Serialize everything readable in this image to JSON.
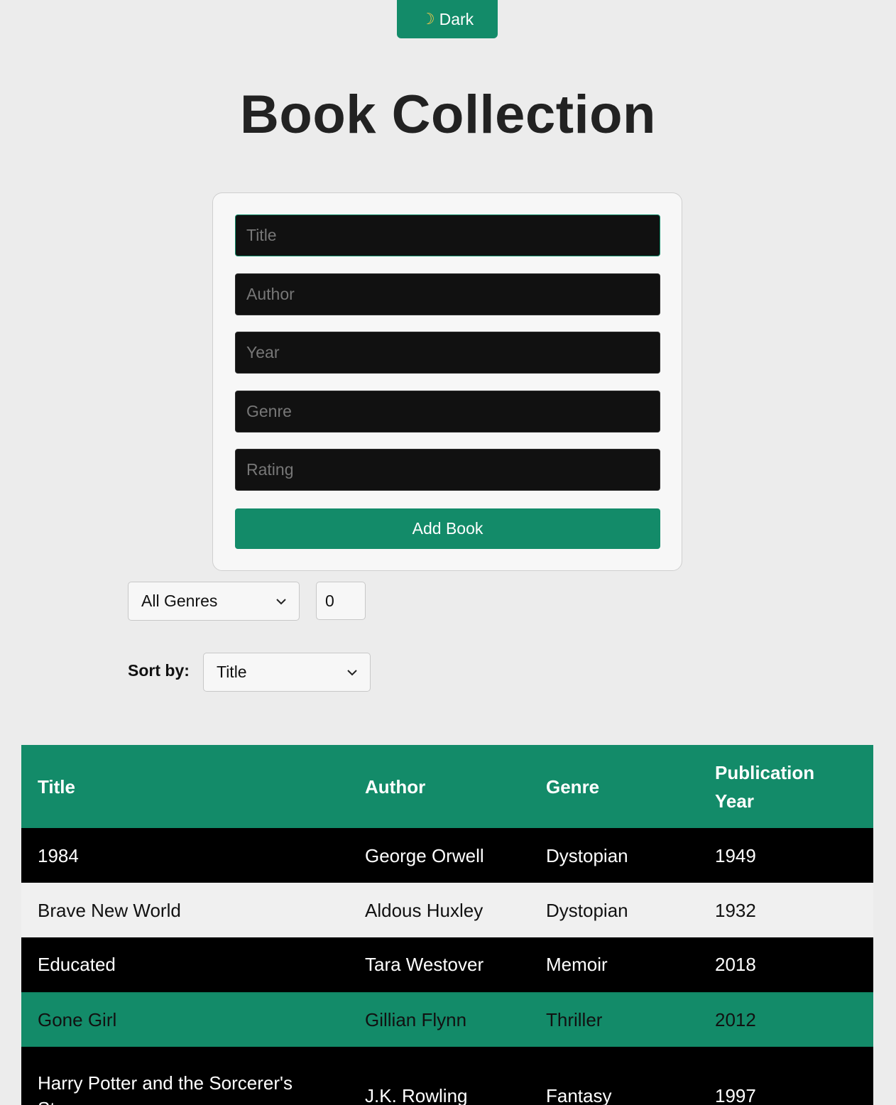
{
  "theme_toggle": {
    "icon": "moon-icon",
    "label": "Dark"
  },
  "page": {
    "title": "Book Collection"
  },
  "form": {
    "title_placeholder": "Title",
    "author_placeholder": "Author",
    "year_placeholder": "Year",
    "genre_placeholder": "Genre",
    "rating_placeholder": "Rating",
    "submit_label": "Add Book"
  },
  "filters": {
    "genre_selected": "All Genres",
    "min_rating_value": "0",
    "sort_label": "Sort by:",
    "sort_selected": "Title"
  },
  "table": {
    "headers": [
      "Title",
      "Author",
      "Genre",
      "Publication Year"
    ],
    "rows": [
      [
        "1984",
        "George Orwell",
        "Dystopian",
        "1949"
      ],
      [
        "Brave New World",
        "Aldous Huxley",
        "Dystopian",
        "1932"
      ],
      [
        "Educated",
        "Tara Westover",
        "Memoir",
        "2018"
      ],
      [
        "Gone Girl",
        "Gillian Flynn",
        "Thriller",
        "2012"
      ],
      [
        "Harry Potter and the Sorcerer's Stone",
        "J.K. Rowling",
        "Fantasy",
        "1997"
      ]
    ]
  },
  "colors": {
    "accent": "#138b69",
    "background": "#ececec",
    "row_dark": "#000000",
    "row_light": "#f0f0f0"
  }
}
